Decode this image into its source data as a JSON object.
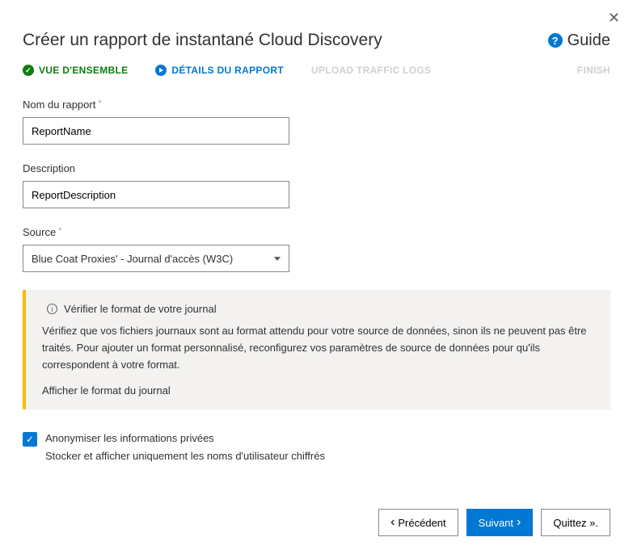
{
  "title": "Créer un rapport de instantané Cloud Discovery",
  "guide_label": "Guide",
  "steps": {
    "s1": "VUE D'ENSEMBLE",
    "s2": "DÉTAILS DU RAPPORT",
    "s3": "UPLOAD TRAFFIC LOGS",
    "s4": "FINISH"
  },
  "form": {
    "name_label": "Nom du rapport",
    "name_value": "ReportName",
    "desc_label": "Description",
    "desc_value": "ReportDescription",
    "source_label": "Source",
    "source_value": "Blue Coat Proxies' - Journal d'accès (W3C)"
  },
  "info": {
    "title": "Vérifier le format de votre journal",
    "body": "Vérifiez que vos fichiers journaux sont au format attendu pour votre source de données, sinon ils ne peuvent pas être traités. Pour ajouter un format personnalisé, reconfigurez vos paramètres de source de données pour qu'ils correspondent à votre format.",
    "link": "Afficher le format du journal"
  },
  "anonymize": {
    "label": "Anonymiser les informations privées",
    "sub": "Stocker et afficher uniquement les noms d'utilisateur chiffrés"
  },
  "buttons": {
    "prev": "Précédent",
    "next": "Suivant",
    "quit": "Quittez »."
  }
}
